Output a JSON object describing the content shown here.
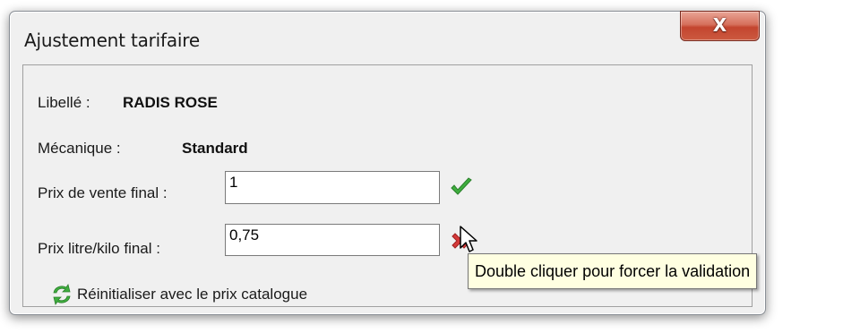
{
  "window": {
    "title": "Ajustement tarifaire",
    "close_label": "X"
  },
  "form": {
    "libelle_label": "Libellé :",
    "libelle_value": "RADIS ROSE",
    "mecanique_label": "Mécanique :",
    "mecanique_value": "Standard",
    "prix_vente_label": "Prix de vente final :",
    "prix_vente_value": "1",
    "prix_vente_status_icon": "check-icon",
    "prix_litre_label": "Prix litre/kilo final :",
    "prix_litre_value": "0,75",
    "prix_litre_status_icon": "cross-icon"
  },
  "reset": {
    "label": "Réinitialiser avec le prix catalogue",
    "icon": "refresh-icon"
  },
  "tooltip": {
    "text": "Double cliquer pour forcer la validation"
  },
  "colors": {
    "valid_green": "#3fae3f",
    "invalid_red": "#d43a3a",
    "tooltip_bg": "#ffffe1",
    "close_red": "#c3452f"
  }
}
